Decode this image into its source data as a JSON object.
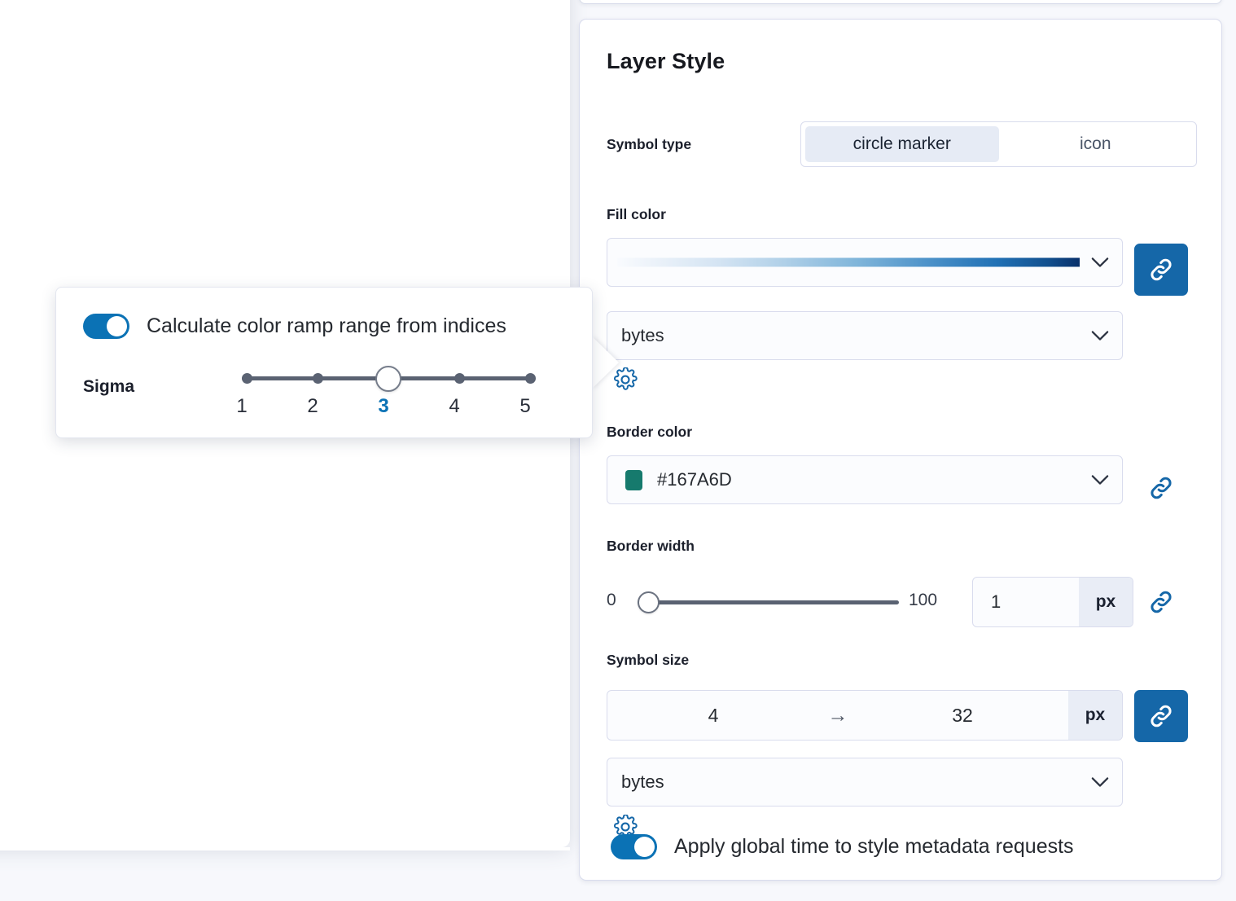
{
  "panel": {
    "title": "Layer Style",
    "symbol_type": {
      "label": "Symbol type",
      "options": [
        "circle marker",
        "icon"
      ],
      "selected": "circle marker"
    },
    "fill_color": {
      "label": "Fill color",
      "ramp_name": "Blues",
      "ramp_stops": [
        "#f9fbfe",
        "#d4e4f3",
        "#7fb5da",
        "#2171b5",
        "#08306b"
      ],
      "field": "bytes",
      "gear_icon": "gear-icon",
      "chevron_icon": "chevron-down-icon",
      "link_icon": "link-icon",
      "link_active": true
    },
    "border_color": {
      "label": "Border color",
      "value": "#167A6D",
      "swatch_color": "#167A6D",
      "chevron_icon": "chevron-down-icon",
      "link_icon": "link-icon",
      "link_active": false
    },
    "border_width": {
      "label": "Border width",
      "min": "0",
      "max": "100",
      "value": "1",
      "unit": "px",
      "link_icon": "link-icon",
      "link_active": false
    },
    "symbol_size": {
      "label": "Symbol size",
      "min": "4",
      "max": "32",
      "arrow": "→",
      "unit": "px",
      "field": "bytes",
      "gear_icon": "gear-icon",
      "chevron_icon": "chevron-down-icon",
      "link_icon": "link-icon",
      "link_active": true
    },
    "apply_global_time": {
      "label": "Apply global time to style metadata requests",
      "enabled": true
    }
  },
  "popover": {
    "toggle": {
      "label": "Calculate color ramp range from indices",
      "enabled": true
    },
    "sigma": {
      "label": "Sigma",
      "ticks": [
        "1",
        "2",
        "3",
        "4",
        "5"
      ],
      "value": "3",
      "selected_index": 2
    }
  },
  "colors": {
    "accent": "#0b72b5",
    "link_button": "#1567a8",
    "border_swatch": "#167A6D",
    "track": "#5a6272"
  }
}
